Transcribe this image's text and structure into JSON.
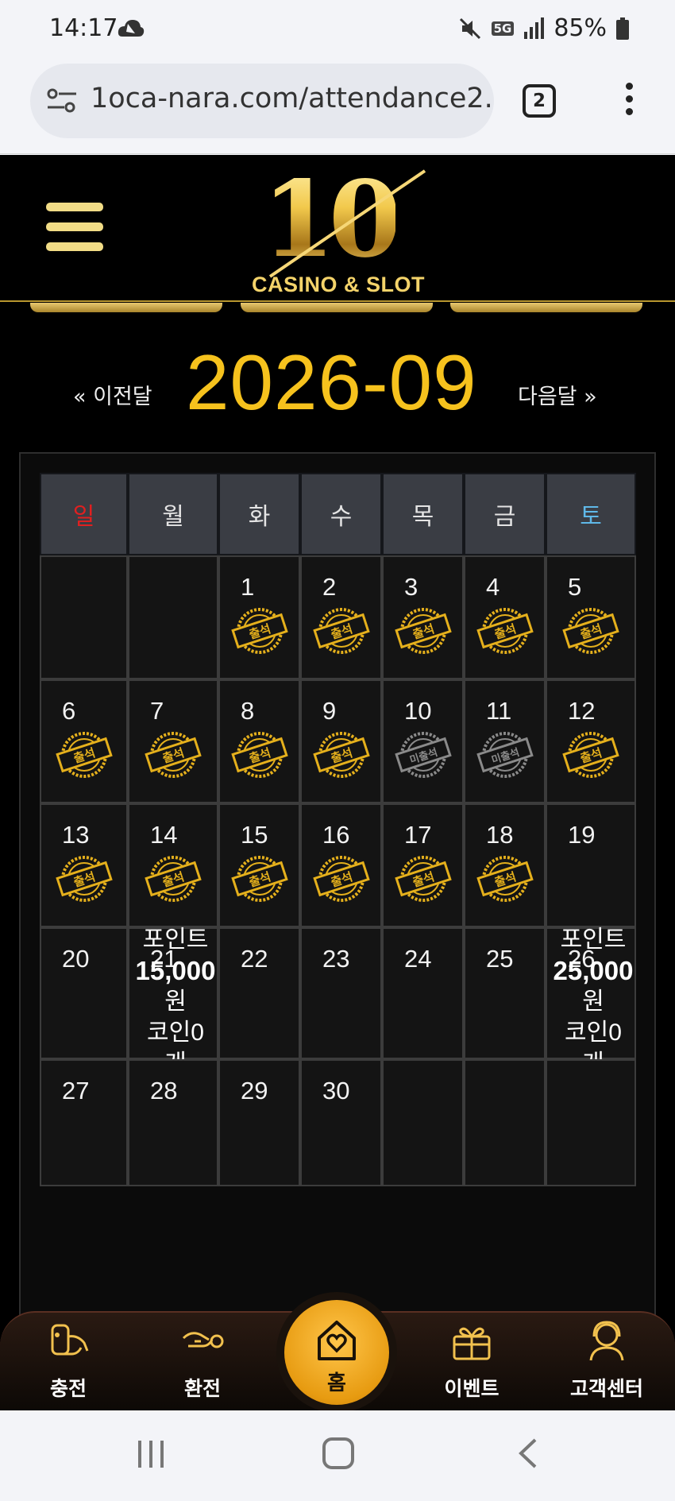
{
  "status_bar": {
    "time": "14:17",
    "network": "5G",
    "battery": "85%",
    "icons": [
      "cloud-icon",
      "mute-icon",
      "signal-icon",
      "battery-icon"
    ]
  },
  "browser": {
    "url": "1oca-nara.com/attendance2.",
    "tab_count": "2"
  },
  "header": {
    "logo_number": "10",
    "logo_text": "CASINO & SLOT"
  },
  "calendar": {
    "month": "2026-09",
    "prev_label": "« 이전달",
    "next_label": "다음달 »",
    "weekdays": [
      "일",
      "월",
      "화",
      "수",
      "목",
      "금",
      "토"
    ],
    "colors": {
      "sunday": "#e02020",
      "saturday": "#5fb8e8",
      "weekday": "#e4e4e4",
      "present_stamp": "#e5b01c",
      "absent_stamp": "#8a8a8a"
    },
    "stamp_texts": {
      "present": "출석",
      "absent": "미출석"
    },
    "weeks": [
      [
        {
          "day": ""
        },
        {
          "day": ""
        },
        {
          "day": "1",
          "stamp": "present"
        },
        {
          "day": "2",
          "stamp": "present"
        },
        {
          "day": "3",
          "stamp": "present"
        },
        {
          "day": "4",
          "stamp": "present"
        },
        {
          "day": "5",
          "stamp": "present"
        }
      ],
      [
        {
          "day": "6",
          "stamp": "present"
        },
        {
          "day": "7",
          "stamp": "present"
        },
        {
          "day": "8",
          "stamp": "present"
        },
        {
          "day": "9",
          "stamp": "present"
        },
        {
          "day": "10",
          "stamp": "absent"
        },
        {
          "day": "11",
          "stamp": "absent"
        },
        {
          "day": "12",
          "stamp": "present"
        }
      ],
      [
        {
          "day": "13",
          "stamp": "present"
        },
        {
          "day": "14",
          "stamp": "present"
        },
        {
          "day": "15",
          "stamp": "present"
        },
        {
          "day": "16",
          "stamp": "present"
        },
        {
          "day": "17",
          "stamp": "present"
        },
        {
          "day": "18",
          "stamp": "present"
        },
        {
          "day": "19"
        }
      ],
      [
        {
          "day": "20"
        },
        {
          "day": "21",
          "reward": [
            "포인트",
            "15,000",
            "원",
            "코인0",
            "개"
          ]
        },
        {
          "day": "22"
        },
        {
          "day": "23"
        },
        {
          "day": "24"
        },
        {
          "day": "25"
        },
        {
          "day": "26",
          "reward": [
            "포인트",
            "25,000",
            "원",
            "코인0",
            "개"
          ]
        }
      ],
      [
        {
          "day": "27"
        },
        {
          "day": "28"
        },
        {
          "day": "29"
        },
        {
          "day": "30"
        },
        {
          "day": ""
        },
        {
          "day": ""
        },
        {
          "day": ""
        }
      ]
    ]
  },
  "bottom_nav": {
    "items": [
      {
        "label": "충전",
        "icon": "charge-icon"
      },
      {
        "label": "환전",
        "icon": "exchange-icon"
      },
      {
        "label": "홈",
        "icon": "home-heart-icon"
      },
      {
        "label": "이벤트",
        "icon": "gift-icon"
      },
      {
        "label": "고객센터",
        "icon": "support-agent-icon"
      }
    ]
  }
}
